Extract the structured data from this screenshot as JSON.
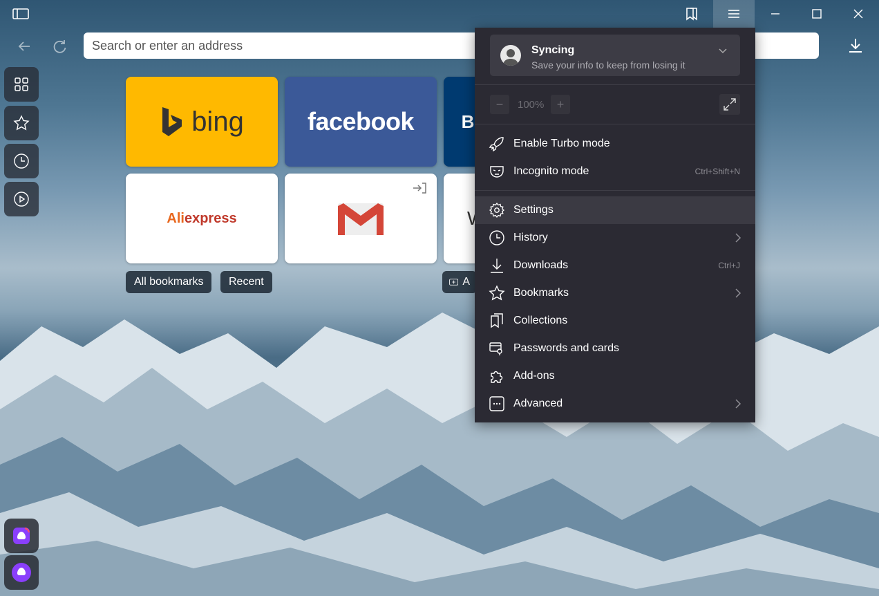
{
  "address_bar": {
    "placeholder": "Search or enter an address"
  },
  "tiles": [
    {
      "name": "bing",
      "label": "bing",
      "color": "#ffb900"
    },
    {
      "name": "facebook",
      "label": "facebook",
      "color": "#3b5998"
    },
    {
      "name": "partial-tile",
      "label": "B",
      "color": "#003a70"
    },
    {
      "name": "aliexpress",
      "label_ali": "Ali",
      "label_express": "express"
    },
    {
      "name": "gmail",
      "label": "M"
    },
    {
      "name": "partial-tile-w",
      "label": "W"
    }
  ],
  "chips": {
    "all_bookmarks": "All bookmarks",
    "recent": "Recent",
    "add": "A"
  },
  "menu": {
    "sync_title": "Syncing",
    "sync_subtitle": "Save your info to keep from losing it",
    "zoom_minus": "−",
    "zoom_value": "100%",
    "zoom_plus": "+",
    "items": [
      {
        "label": "Enable Turbo mode",
        "icon": "rocket-icon",
        "shortcut": ""
      },
      {
        "label": "Incognito mode",
        "icon": "mask-icon",
        "shortcut": "Ctrl+Shift+N"
      },
      {
        "label": "Settings",
        "icon": "gear-icon",
        "shortcut": ""
      },
      {
        "label": "History",
        "icon": "clock-icon",
        "shortcut": ""
      },
      {
        "label": "Downloads",
        "icon": "download-icon",
        "shortcut": "Ctrl+J"
      },
      {
        "label": "Bookmarks",
        "icon": "star-icon",
        "shortcut": ""
      },
      {
        "label": "Collections",
        "icon": "collections-icon",
        "shortcut": ""
      },
      {
        "label": "Passwords and cards",
        "icon": "key-card-icon",
        "shortcut": ""
      },
      {
        "label": "Add-ons",
        "icon": "puzzle-icon",
        "shortcut": ""
      },
      {
        "label": "Advanced",
        "icon": "more-icon",
        "shortcut": ""
      }
    ]
  },
  "colors": {
    "menu_bg": "#2b2a33",
    "menu_highlight": "#3b3a43"
  }
}
